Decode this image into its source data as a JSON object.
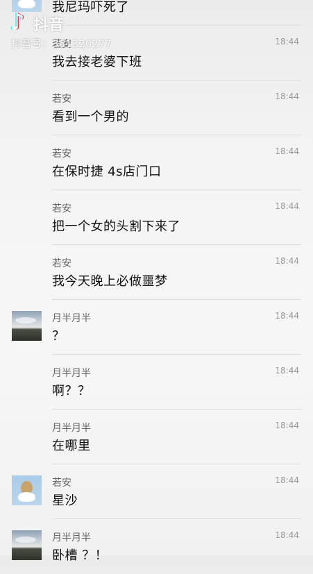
{
  "watermark": {
    "app_icon": "tiktok-note-icon",
    "brand": "抖音",
    "account_id": "抖音号：361320277"
  },
  "messages": [
    {
      "name": "",
      "time": "",
      "text": "我尼玛吓死了",
      "avatar": "bear"
    },
    {
      "name": "若安",
      "time": "18:44",
      "text": "我去接老婆下班",
      "avatar": ""
    },
    {
      "name": "若安",
      "time": "18:44",
      "text": "看到一个男的",
      "avatar": ""
    },
    {
      "name": "若安",
      "time": "18:44",
      "text": "在保时捷 4s店门口",
      "avatar": ""
    },
    {
      "name": "若安",
      "time": "18:44",
      "text": "把一个女的头割下来了",
      "avatar": ""
    },
    {
      "name": "若安",
      "time": "18:44",
      "text": "我今天晚上必做噩梦",
      "avatar": ""
    },
    {
      "name": "月半月半",
      "time": "18:44",
      "text": "？",
      "avatar": "sky"
    },
    {
      "name": "月半月半",
      "time": "18:44",
      "text": "啊？？",
      "avatar": ""
    },
    {
      "name": "月半月半",
      "time": "18:44",
      "text": "在哪里",
      "avatar": ""
    },
    {
      "name": "若安",
      "time": "18:44",
      "text": "星沙",
      "avatar": "bear"
    },
    {
      "name": "月半月半",
      "time": "18:44",
      "text": "卧槽 ？！",
      "avatar": "sky"
    }
  ]
}
